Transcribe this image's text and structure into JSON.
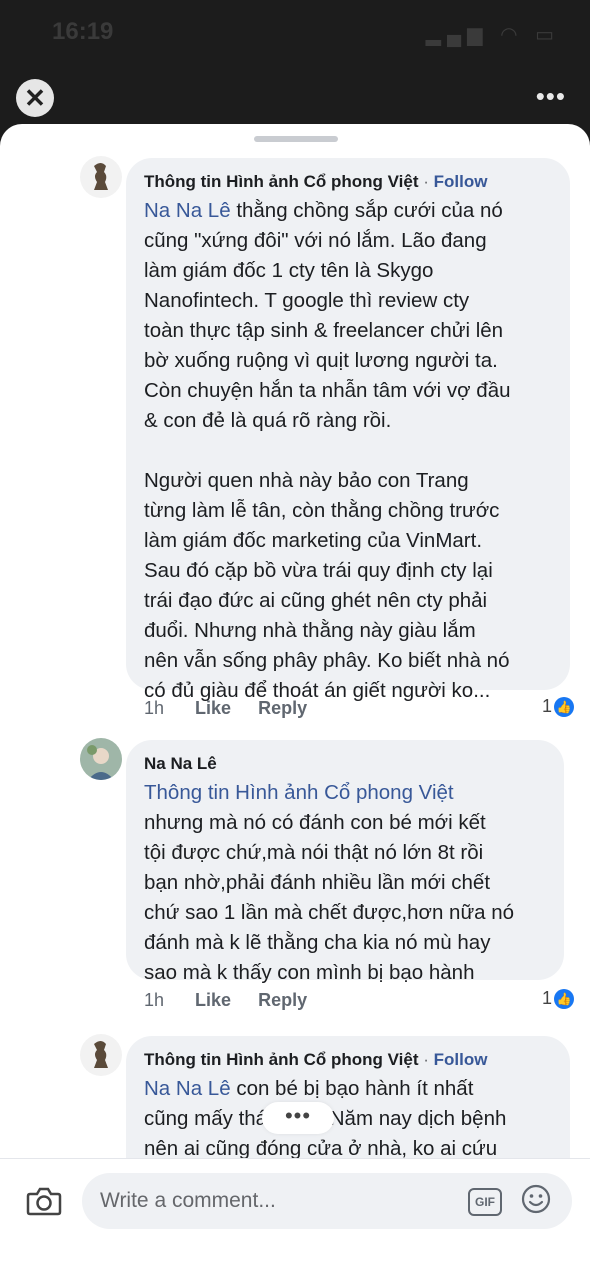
{
  "status": {
    "time": "16:19"
  },
  "comments": [
    {
      "author": "Thông tin Hình ảnh Cổ phong Việt",
      "follow": "Follow",
      "mention": "Na Na Lê",
      "lines": [
        "thằng chồng sắp cưới của nó",
        "cũng \"xứng đôi\" với nó lắm. Lão đang",
        "làm giám đốc 1 cty tên là Skygo",
        "Nanofintech. T google thì review cty",
        "toàn thực tập sinh & freelancer chửi lên",
        "bờ xuống ruộng vì quịt lương người ta.",
        "Còn chuyện hắn ta nhẫn tâm với vợ đầu",
        "& con đẻ là quá rõ ràng rồi.",
        "",
        "Người quen nhà này bảo con Trang",
        "từng làm lễ tân, còn thằng chồng trước",
        "làm giám đốc marketing của VinMart.",
        "Sau đó cặp bồ vừa trái quy định cty lại",
        "trái đạo đức ai cũng ghét nên cty phải",
        "đuổi. Nhưng nhà thằng này giàu lắm",
        "nên vẫn sống phây phây. Ko biết nhà nó",
        "có đủ giàu để thoát án giết người ko..."
      ],
      "time": "1h",
      "like": "Like",
      "reply": "Reply",
      "reactions": "1"
    },
    {
      "author": "Na Na Lê",
      "mention": "Thông tin Hình ảnh Cổ phong Việt",
      "lines": [
        "nhưng mà nó có đánh con bé mới kết",
        "tội được chứ,mà nói thật nó lớn 8t rồi",
        "bạn nhờ,phải đánh nhiều lần mới chết",
        "chứ sao 1 lần mà chết được,hơn nữa nó",
        "đánh mà k lẽ thằng cha kia nó mù hay",
        "sao mà k thấy con mình bị bạo hành"
      ],
      "time": "1h",
      "like": "Like",
      "reply": "Reply",
      "reactions": "1"
    },
    {
      "author": "Thông tin Hình ảnh Cổ phong Việt",
      "follow": "Follow",
      "mention": "Na Na Lê",
      "lines": [
        "con bé bị bạo hành ít nhất",
        "cũng mấy tháng rồi. Năm nay dịch bệnh",
        "nên ai cũng đóng cửa ở nhà, ko ai cứu"
      ]
    }
  ],
  "typing_indicator": "•••",
  "composer": {
    "placeholder": "Write a comment...",
    "gif": "GIF"
  },
  "colors": {
    "link": "#385898",
    "bubble": "#eff1f4",
    "like_blue": "#1877f2"
  }
}
